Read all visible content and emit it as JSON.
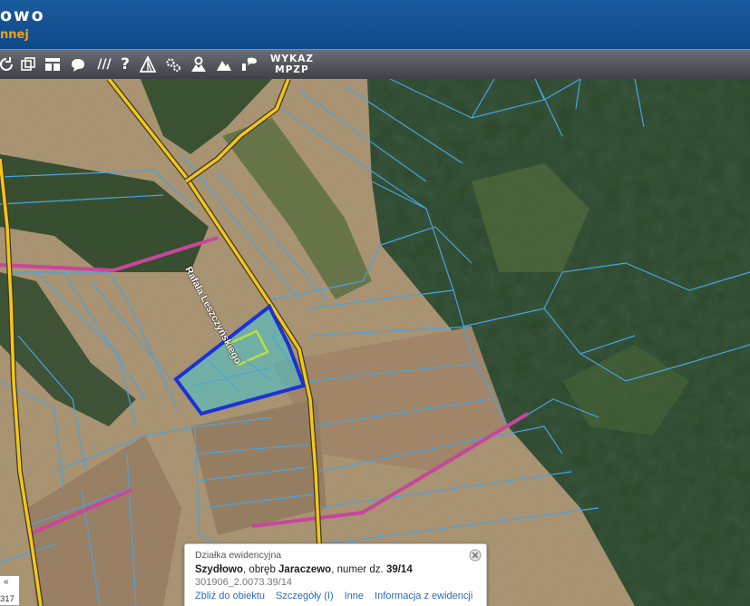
{
  "header": {
    "title": "owo",
    "subtitle": "nnej"
  },
  "toolbar": {
    "buttons": [
      {
        "icon": "refresh-icon"
      },
      {
        "icon": "copy-window-icon"
      },
      {
        "icon": "layout-grid-icon"
      },
      {
        "icon": "speech-cloud-icon"
      },
      {
        "icon": "hatch-lines-icon",
        "label": "///"
      },
      {
        "icon": "help-icon",
        "label": "?"
      },
      {
        "icon": "measure-tent-icon"
      },
      {
        "icon": "settings-gears-icon"
      },
      {
        "icon": "terrain-profile-icon"
      },
      {
        "icon": "mountain-icon"
      },
      {
        "icon": "info-chat-icon"
      }
    ],
    "wykaz_line1": "WYKAZ",
    "wykaz_line2": "MPZP"
  },
  "map": {
    "road_label": "Rafała Leszczyńskiego",
    "colors": {
      "road": "#f5c518",
      "boundary": "#4aa3e0",
      "purple_line": "#c8469e",
      "selected_outline": "#1a32d6",
      "selected_fill": "#2fd2e6",
      "building": "#b7e03a"
    }
  },
  "popup": {
    "title": "Działka ewidencyjna",
    "place": "Szydłowo",
    "obreb_text": ", obręb ",
    "obreb": "Jaraczewo",
    "numer_text": ", numer dz. ",
    "numer": "39/14",
    "id": "301906_2.0073.39/14",
    "links": [
      "Zbliż do obiektu",
      "Szczegóły (I)",
      "Inne",
      "Informacja z ewidencji"
    ]
  },
  "scale": {
    "chevron": "«",
    "value": "317"
  }
}
